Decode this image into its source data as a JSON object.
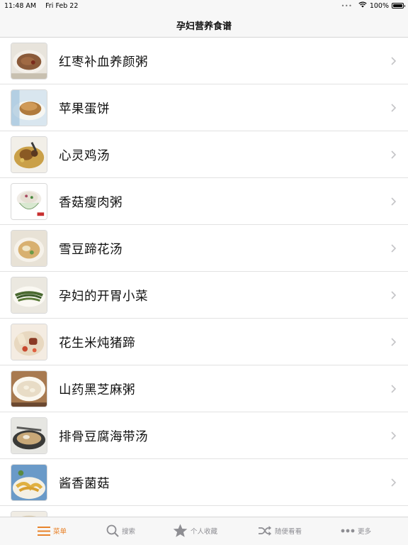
{
  "status_bar": {
    "time": "11:48 AM",
    "date": "Fri Feb 22",
    "battery_percent": "100%",
    "battery_level": 1.0
  },
  "nav": {
    "title": "孕妇营养食谱"
  },
  "recipes": [
    {
      "name": "红枣补血养颜粥"
    },
    {
      "name": "苹果蛋饼"
    },
    {
      "name": "心灵鸡汤"
    },
    {
      "name": "香菇瘦肉粥"
    },
    {
      "name": "雪豆蹄花汤"
    },
    {
      "name": "孕妇的开胃小菜"
    },
    {
      "name": "花生米炖猪蹄"
    },
    {
      "name": "山药黑芝麻粥"
    },
    {
      "name": "排骨豆腐海带汤"
    },
    {
      "name": "酱香菌菇"
    }
  ],
  "tabs": [
    {
      "label": "菜单",
      "icon": "menu-icon",
      "active": true
    },
    {
      "label": "搜索",
      "icon": "search-icon",
      "active": false
    },
    {
      "label": "个人收藏",
      "icon": "star-icon",
      "active": false
    },
    {
      "label": "随便看看",
      "icon": "shuffle-icon",
      "active": false
    },
    {
      "label": "更多",
      "icon": "more-icon",
      "active": false
    }
  ],
  "colors": {
    "accent": "#e8832a",
    "inactive": "#8e8e93",
    "bar_background": "#f7f7f7"
  }
}
